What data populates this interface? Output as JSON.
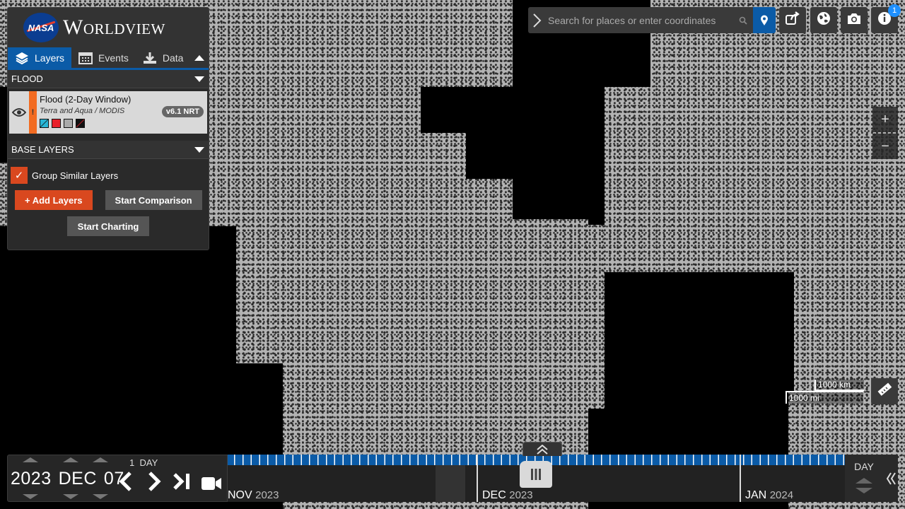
{
  "app": {
    "logo_text": "NASA",
    "title": "Worldview"
  },
  "tabs": [
    {
      "label": "Layers",
      "icon": "layers-icon"
    },
    {
      "label": "Events",
      "icon": "calendar-icon"
    },
    {
      "label": "Data",
      "icon": "download-icon"
    }
  ],
  "overlays": {
    "heading": "FLOOD",
    "layer": {
      "name": "Flood (2-Day Window)",
      "source": "Terra and Aqua / MODIS",
      "badge": "v6.1 NRT",
      "warning": "!"
    }
  },
  "base_layers": {
    "heading": "BASE LAYERS"
  },
  "group_similar": {
    "label": "Group Similar Layers",
    "checked": true,
    "check_mark": "✓"
  },
  "buttons": {
    "add_layers": "+ Add Layers",
    "start_comparison": "Start Comparison",
    "start_charting": "Start Charting"
  },
  "search": {
    "placeholder": "Search for places or enter coordinates"
  },
  "notifications": {
    "count": "1"
  },
  "zoom": {
    "in": "+",
    "out": "−"
  },
  "scale": {
    "km": "1000 km",
    "mi": "1000 mi"
  },
  "date": {
    "year": "2023",
    "month": "DEC",
    "day": "07",
    "interval_count": "1",
    "interval_unit": "DAY"
  },
  "timeline": {
    "months": [
      {
        "month": "NOV",
        "year": "2023"
      },
      {
        "month": "DEC",
        "year": "2023"
      },
      {
        "month": "JAN",
        "year": "2024"
      }
    ],
    "zoom_level": "DAY"
  },
  "colors": {
    "accent_blue": "#0b5ba7",
    "accent_orange": "#d9481f",
    "warning_orange": "#f26b21",
    "map_gray": "#b3b3b3",
    "legend": [
      "#29b6d6",
      "#e8202a",
      "#aaaaaa",
      "#111111"
    ]
  }
}
